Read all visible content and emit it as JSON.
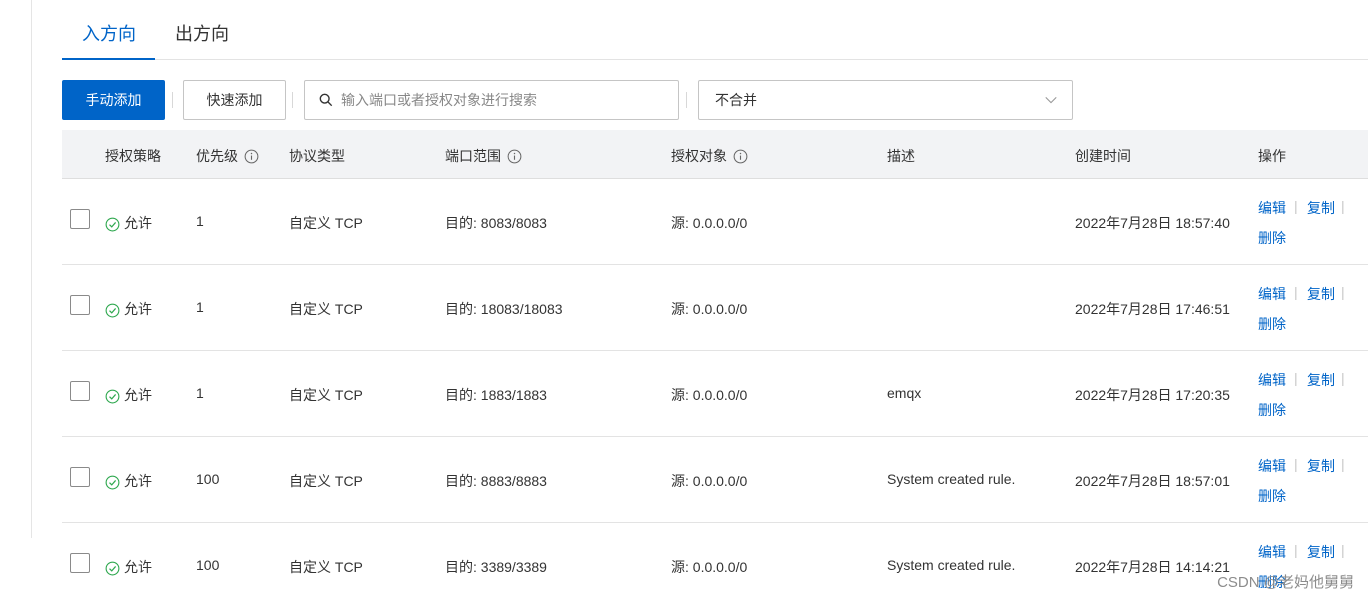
{
  "tabs": [
    {
      "label": "入方向",
      "active": true
    },
    {
      "label": "出方向",
      "active": false
    }
  ],
  "toolbar": {
    "manual_add_label": "手动添加",
    "quick_add_label": "快速添加",
    "search_placeholder": "输入端口或者授权对象进行搜索",
    "merge_select_value": "不合并"
  },
  "table": {
    "headers": {
      "policy": "授权策略",
      "priority": "优先级",
      "protocol": "协议类型",
      "port": "端口范围",
      "target": "授权对象",
      "description": "描述",
      "created": "创建时间",
      "actions": "操作"
    },
    "rows": [
      {
        "policy": "允许",
        "priority": "1",
        "protocol": "自定义 TCP",
        "port": "目的: 8083/8083",
        "target": "源: 0.0.0.0/0",
        "description": "",
        "created": "2022年7月28日 18:57:40",
        "edit": "编辑",
        "copy": "复制",
        "delete": "删除"
      },
      {
        "policy": "允许",
        "priority": "1",
        "protocol": "自定义 TCP",
        "port": "目的: 18083/18083",
        "target": "源: 0.0.0.0/0",
        "description": "",
        "created": "2022年7月28日 17:46:51",
        "edit": "编辑",
        "copy": "复制",
        "delete": "删除"
      },
      {
        "policy": "允许",
        "priority": "1",
        "protocol": "自定义 TCP",
        "port": "目的: 1883/1883",
        "target": "源: 0.0.0.0/0",
        "description": "emqx",
        "created": "2022年7月28日 17:20:35",
        "edit": "编辑",
        "copy": "复制",
        "delete": "删除"
      },
      {
        "policy": "允许",
        "priority": "100",
        "protocol": "自定义 TCP",
        "port": "目的: 8883/8883",
        "target": "源: 0.0.0.0/0",
        "description": "System created rule.",
        "created": "2022年7月28日 18:57:01",
        "edit": "编辑",
        "copy": "复制",
        "delete": "删除"
      },
      {
        "policy": "允许",
        "priority": "100",
        "protocol": "自定义 TCP",
        "port": "目的: 3389/3389",
        "target": "源: 0.0.0.0/0",
        "description": "System created rule.",
        "created": "2022年7月28日 14:14:21",
        "edit": "编辑",
        "copy": "复制",
        "delete": "删除"
      }
    ]
  },
  "watermark": "CSDN @老妈他舅舅",
  "colors": {
    "accent": "#0064c8",
    "success": "#2fa84f",
    "header_bg": "#f2f3f5"
  },
  "icons": {
    "search": "search-icon",
    "chevron": "chevron-down-icon",
    "info": "info-icon",
    "allow": "check-circle-icon"
  }
}
